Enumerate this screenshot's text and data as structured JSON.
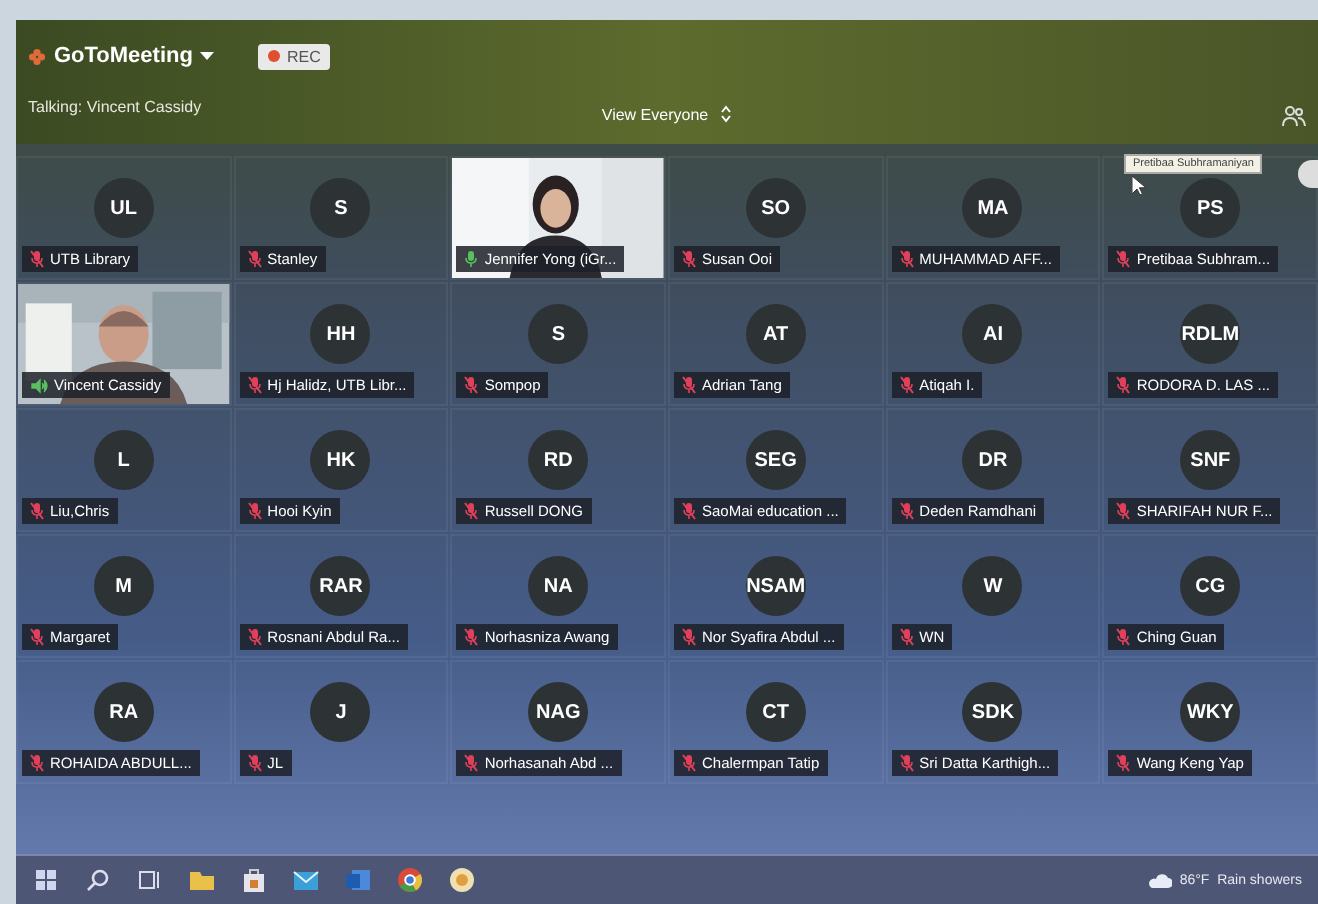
{
  "header": {
    "app_name": "GoToMeeting",
    "rec_label": "REC",
    "talking": "Talking: Vincent Cassidy",
    "view": "View Everyone"
  },
  "tooltip": "Pretibaa Subhramaniyan",
  "participants": [
    {
      "kind": "avatar",
      "initials": "UL",
      "name": "UTB Library",
      "muted": true,
      "talking": false
    },
    {
      "kind": "avatar",
      "initials": "S",
      "name": "Stanley",
      "muted": true,
      "talking": false
    },
    {
      "kind": "video",
      "name": "Jennifer Yong (iGr...",
      "muted": false,
      "talking": false
    },
    {
      "kind": "avatar",
      "initials": "SO",
      "name": "Susan Ooi",
      "muted": true,
      "talking": false
    },
    {
      "kind": "avatar",
      "initials": "MA",
      "name": "MUHAMMAD AFF...",
      "muted": true,
      "talking": false
    },
    {
      "kind": "avatar",
      "initials": "PS",
      "name": "Pretibaa Subhram...",
      "muted": true,
      "talking": false
    },
    {
      "kind": "video",
      "name": "Vincent Cassidy",
      "muted": false,
      "talking": true
    },
    {
      "kind": "avatar",
      "initials": "HH",
      "name": "Hj Halidz, UTB Libr...",
      "muted": true,
      "talking": false
    },
    {
      "kind": "avatar",
      "initials": "S",
      "name": "Sompop",
      "muted": true,
      "talking": false
    },
    {
      "kind": "avatar",
      "initials": "AT",
      "name": "Adrian Tang",
      "muted": true,
      "talking": false
    },
    {
      "kind": "avatar",
      "initials": "AI",
      "name": "Atiqah I.",
      "muted": true,
      "talking": false
    },
    {
      "kind": "avatar",
      "initials": "RDLM",
      "name": "RODORA D. LAS ...",
      "muted": true,
      "talking": false
    },
    {
      "kind": "avatar",
      "initials": "L",
      "name": "Liu,Chris",
      "muted": true,
      "talking": false
    },
    {
      "kind": "avatar",
      "initials": "HK",
      "name": "Hooi Kyin",
      "muted": true,
      "talking": false
    },
    {
      "kind": "avatar",
      "initials": "RD",
      "name": "Russell DONG",
      "muted": true,
      "talking": false
    },
    {
      "kind": "avatar",
      "initials": "SEG",
      "name": "SaoMai education ...",
      "muted": true,
      "talking": false
    },
    {
      "kind": "avatar",
      "initials": "DR",
      "name": "Deden Ramdhani",
      "muted": true,
      "talking": false
    },
    {
      "kind": "avatar",
      "initials": "SNF",
      "name": "SHARIFAH NUR F...",
      "muted": true,
      "talking": false
    },
    {
      "kind": "avatar",
      "initials": "M",
      "name": "Margaret",
      "muted": true,
      "talking": false
    },
    {
      "kind": "avatar",
      "initials": "RAR",
      "name": "Rosnani Abdul Ra...",
      "muted": true,
      "talking": false
    },
    {
      "kind": "avatar",
      "initials": "NA",
      "name": "Norhasniza Awang",
      "muted": true,
      "talking": false
    },
    {
      "kind": "avatar",
      "initials": "NSAM",
      "name": "Nor Syafira Abdul ...",
      "muted": true,
      "talking": false
    },
    {
      "kind": "avatar",
      "initials": "W",
      "name": "WN",
      "muted": true,
      "talking": false
    },
    {
      "kind": "avatar",
      "initials": "CG",
      "name": "Ching Guan",
      "muted": true,
      "talking": false
    },
    {
      "kind": "avatar",
      "initials": "RA",
      "name": "ROHAIDA ABDULL...",
      "muted": true,
      "talking": false
    },
    {
      "kind": "avatar",
      "initials": "J",
      "name": "JL",
      "muted": true,
      "talking": false
    },
    {
      "kind": "avatar",
      "initials": "NAG",
      "name": "Norhasanah Abd ...",
      "muted": true,
      "talking": false
    },
    {
      "kind": "avatar",
      "initials": "CT",
      "name": "Chalermpan Tatip",
      "muted": true,
      "talking": false
    },
    {
      "kind": "avatar",
      "initials": "SDK",
      "name": "Sri Datta Karthigh...",
      "muted": true,
      "talking": false
    },
    {
      "kind": "avatar",
      "initials": "WKY",
      "name": "Wang Keng Yap",
      "muted": true,
      "talking": false
    }
  ],
  "taskbar": {
    "weather": "86°F  Rain showers"
  }
}
